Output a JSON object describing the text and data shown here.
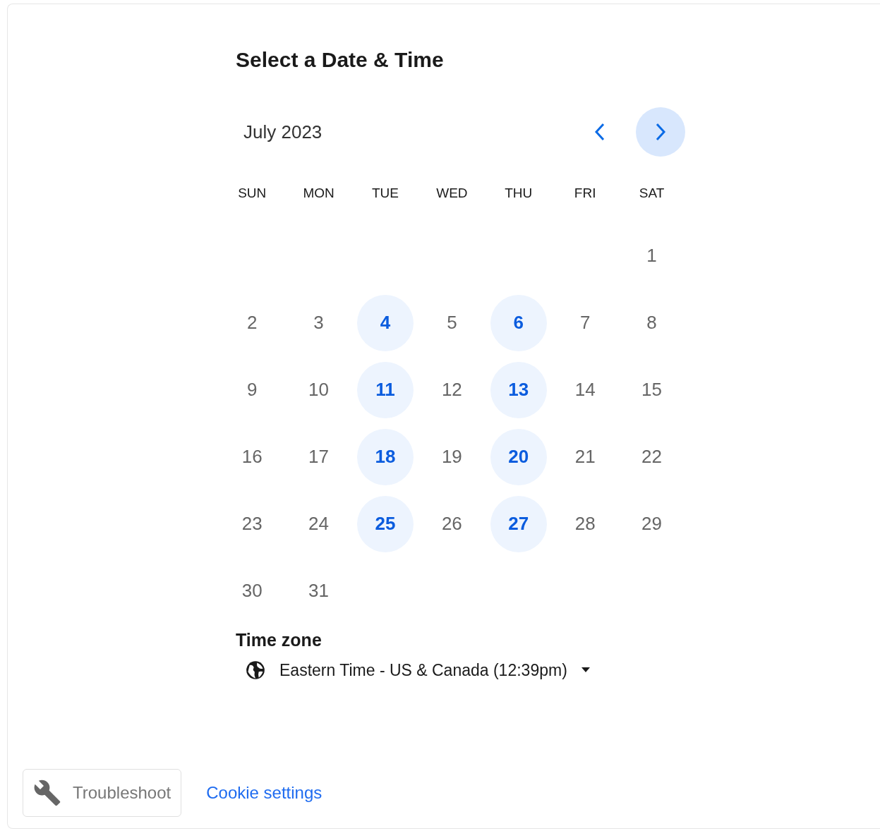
{
  "title": "Select a Date & Time",
  "calendar": {
    "month": "July 2023",
    "weekdays": [
      "SUN",
      "MON",
      "TUE",
      "WED",
      "THU",
      "FRI",
      "SAT"
    ],
    "weeks": [
      [
        {
          "day": "1",
          "available": false
        }
      ],
      [
        {
          "day": "2",
          "available": false
        },
        {
          "day": "3",
          "available": false
        },
        {
          "day": "4",
          "available": true
        },
        {
          "day": "5",
          "available": false
        },
        {
          "day": "6",
          "available": true
        },
        {
          "day": "7",
          "available": false
        },
        {
          "day": "8",
          "available": false
        }
      ],
      [
        {
          "day": "9",
          "available": false
        },
        {
          "day": "10",
          "available": false
        },
        {
          "day": "11",
          "available": true
        },
        {
          "day": "12",
          "available": false
        },
        {
          "day": "13",
          "available": true
        },
        {
          "day": "14",
          "available": false
        },
        {
          "day": "15",
          "available": false
        }
      ],
      [
        {
          "day": "16",
          "available": false
        },
        {
          "day": "17",
          "available": false
        },
        {
          "day": "18",
          "available": true
        },
        {
          "day": "19",
          "available": false
        },
        {
          "day": "20",
          "available": true
        },
        {
          "day": "21",
          "available": false
        },
        {
          "day": "22",
          "available": false
        }
      ],
      [
        {
          "day": "23",
          "available": false
        },
        {
          "day": "24",
          "available": false
        },
        {
          "day": "25",
          "available": true
        },
        {
          "day": "26",
          "available": false
        },
        {
          "day": "27",
          "available": true
        },
        {
          "day": "28",
          "available": false
        },
        {
          "day": "29",
          "available": false
        }
      ],
      [
        {
          "day": "30",
          "available": false
        },
        {
          "day": "31",
          "available": false
        }
      ]
    ]
  },
  "time_zone": {
    "label": "Time zone",
    "value": "Eastern Time - US & Canada (12:39pm)"
  },
  "footer": {
    "troubleshoot": "Troubleshoot",
    "cookie_settings": "Cookie settings"
  }
}
